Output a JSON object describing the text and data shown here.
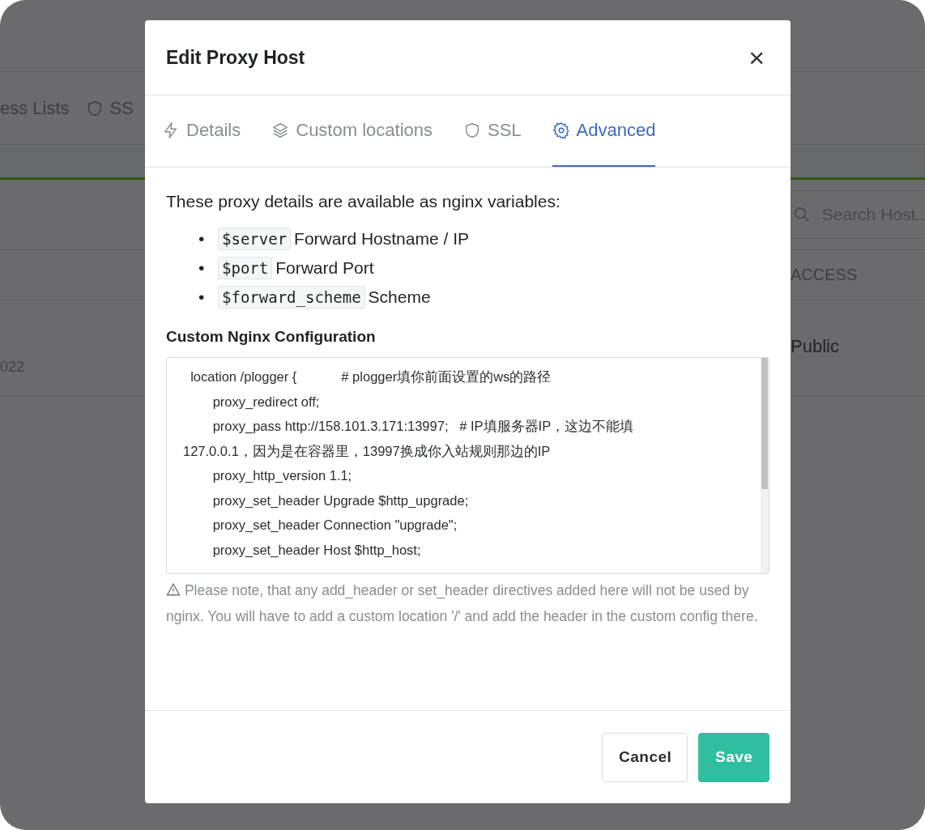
{
  "background": {
    "nav_items": [
      {
        "label": "ess Lists"
      },
      {
        "label": "SS"
      }
    ],
    "search": {
      "placeholder": "Search Host.."
    },
    "column_header": "ACCESS",
    "row": {
      "date_fragment": "022",
      "access": "Public"
    }
  },
  "dialog": {
    "title": "Edit Proxy Host",
    "close": "×",
    "tabs": [
      {
        "label": "Details",
        "kind": "bolt",
        "selected": false
      },
      {
        "label": "Custom locations",
        "kind": "layers",
        "selected": false
      },
      {
        "label": "SSL",
        "kind": "shield",
        "selected": false
      },
      {
        "label": "Advanced",
        "kind": "gear",
        "selected": true
      }
    ],
    "intro": "These proxy details are available as nginx variables:",
    "variables": [
      {
        "bullet": "•",
        "code": "$server",
        "description": "Forward Hostname / IP"
      },
      {
        "bullet": "•",
        "code": "$port",
        "description": "Forward Port"
      },
      {
        "bullet": "•",
        "code": "$forward_scheme",
        "description": "Scheme"
      }
    ],
    "config_label": "Custom Nginx Configuration",
    "config_lines": [
      "  location /plogger {            # plogger填你前面设置的ws的路径",
      "        proxy_redirect off;",
      "        proxy_pass http://158.101.3.171:13997;   # IP填服务器IP，这边不能填",
      "127.0.0.1，因为是在容器里，13997换成你入站规则那边的IP",
      "        proxy_http_version 1.1;",
      "        proxy_set_header Upgrade $http_upgrade;",
      "        proxy_set_header Connection \"upgrade\";",
      "        proxy_set_header Host $http_host;"
    ],
    "note": "Please note, that any add_header or set_header directives added here will not be used by nginx. You will have to add a custom location '/' and add the header in the custom config there.",
    "buttons": [
      {
        "label": "Cancel",
        "kind": "secondary"
      },
      {
        "label": "Save",
        "kind": "primary"
      }
    ]
  }
}
